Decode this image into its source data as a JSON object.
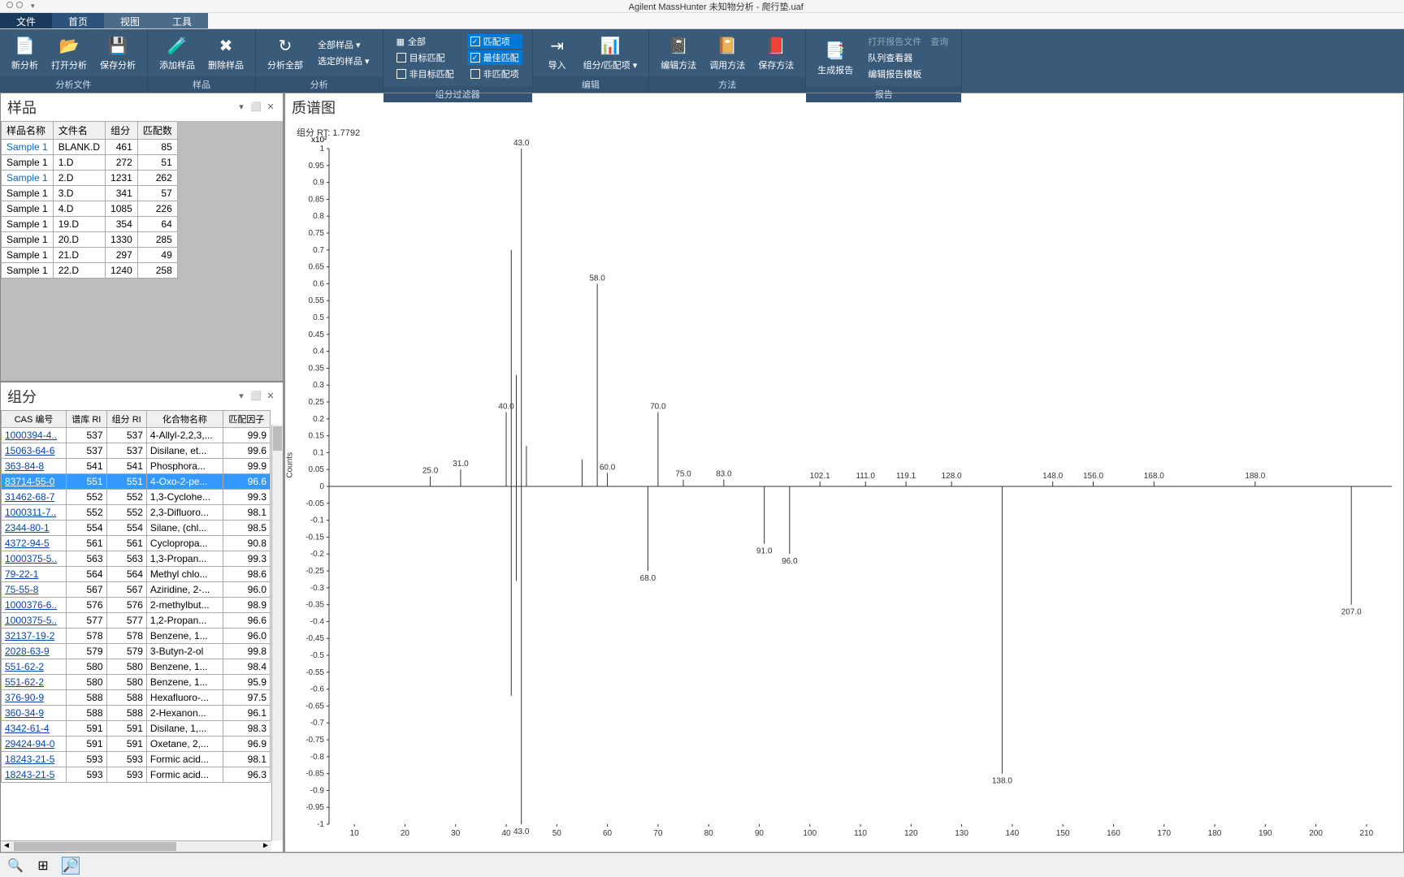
{
  "app_title": "Agilent MassHunter 未知物分析 - 爬行垫.uaf",
  "menu": {
    "file": "文件",
    "home": "首页",
    "view": "视图",
    "tools": "工具"
  },
  "ribbon": {
    "group1": {
      "label": "分析文件",
      "new": "新分析",
      "open": "打开分析",
      "save": "保存分析"
    },
    "group2": {
      "label": "样品",
      "add": "添加样品",
      "remove": "删除样品"
    },
    "group3": {
      "label": "分析",
      "analyze": "分析全部",
      "all_samples": "全部样品 ▾",
      "selected": "选定的样品 ▾"
    },
    "group4": {
      "label": "组分过滤器",
      "all": "全部",
      "target": "目标匹配",
      "nontarget": "非目标匹配",
      "matched": "匹配项",
      "best": "最佳匹配",
      "unmatched": "非匹配项"
    },
    "group5": {
      "label": "编辑",
      "import": "导入",
      "comp": "组分/匹配项 ▾"
    },
    "group6": {
      "label": "方法",
      "edit": "编辑方法",
      "apply": "调用方法",
      "save": "保存方法"
    },
    "group7": {
      "label": "报告",
      "gen": "生成报告",
      "openrpt": "打开报告文件",
      "query": "查询",
      "queue": "队列查看器",
      "edittpl": "编辑报告模板"
    }
  },
  "panels": {
    "samples": "样品",
    "components": "组分",
    "spectrum": "质谱图"
  },
  "samples": {
    "cols": [
      "样品名称",
      "文件名",
      "组分",
      "匹配数"
    ],
    "rows": [
      [
        "Sample 1",
        "BLANK.D",
        "461",
        "85"
      ],
      [
        "Sample 1",
        "1.D",
        "272",
        "51"
      ],
      [
        "Sample 1",
        "2.D",
        "1231",
        "262"
      ],
      [
        "Sample 1",
        "3.D",
        "341",
        "57"
      ],
      [
        "Sample 1",
        "4.D",
        "1085",
        "226"
      ],
      [
        "Sample 1",
        "19.D",
        "354",
        "64"
      ],
      [
        "Sample 1",
        "20.D",
        "1330",
        "285"
      ],
      [
        "Sample 1",
        "21.D",
        "297",
        "49"
      ],
      [
        "Sample 1",
        "22.D",
        "1240",
        "258"
      ]
    ]
  },
  "components": {
    "cols": [
      "CAS 编号",
      "谱库 RI",
      "组分 RI",
      "化合物名称",
      "匹配因子"
    ],
    "rows": [
      [
        "1000394-4..",
        "537",
        "537",
        "4-Allyl-2,2,3,...",
        "99.9"
      ],
      [
        "15063-64-6",
        "537",
        "537",
        "Disilane, et...",
        "99.6"
      ],
      [
        "363-84-8",
        "541",
        "541",
        "Phosphora...",
        "99.9"
      ],
      [
        "83714-55-0",
        "551",
        "551",
        "4-Oxo-2-pe...",
        "96.6"
      ],
      [
        "31462-68-7",
        "552",
        "552",
        "1,3-Cyclohe...",
        "99.3"
      ],
      [
        "1000311-7..",
        "552",
        "552",
        "2,3-Difluoro...",
        "98.1"
      ],
      [
        "2344-80-1",
        "554",
        "554",
        "Silane, (chl...",
        "98.5"
      ],
      [
        "4372-94-5",
        "561",
        "561",
        "Cyclopropa...",
        "90.8"
      ],
      [
        "1000375-5..",
        "563",
        "563",
        "1,3-Propan...",
        "99.3"
      ],
      [
        "79-22-1",
        "564",
        "564",
        "Methyl chlo...",
        "98.6"
      ],
      [
        "75-55-8",
        "567",
        "567",
        "Aziridine, 2-...",
        "96.0"
      ],
      [
        "1000376-6..",
        "576",
        "576",
        "2-methylbut...",
        "98.9"
      ],
      [
        "1000375-5..",
        "577",
        "577",
        "1,2-Propan...",
        "96.6"
      ],
      [
        "32137-19-2",
        "578",
        "578",
        "Benzene, 1...",
        "96.0"
      ],
      [
        "2028-63-9",
        "579",
        "579",
        "3-Butyn-2-ol",
        "99.8"
      ],
      [
        "551-62-2",
        "580",
        "580",
        "Benzene, 1...",
        "98.4"
      ],
      [
        "551-62-2",
        "580",
        "580",
        "Benzene, 1...",
        "95.9"
      ],
      [
        "376-90-9",
        "588",
        "588",
        "Hexafluoro-...",
        "97.5"
      ],
      [
        "360-34-9",
        "588",
        "588",
        "2-Hexanon...",
        "96.1"
      ],
      [
        "4342-61-4",
        "591",
        "591",
        "Disilane, 1,...",
        "98.3"
      ],
      [
        "29424-94-0",
        "591",
        "591",
        "Oxetane, 2,...",
        "96.9"
      ],
      [
        "18243-21-5",
        "593",
        "593",
        "Formic acid...",
        "98.1"
      ],
      [
        "18243-21-5",
        "593",
        "593",
        "Formic acid...",
        "96.3"
      ]
    ],
    "highlight_index": 3
  },
  "chart_data": {
    "type": "bar",
    "title": "组分 RT: 1.7792",
    "ylabel": "Counts",
    "ymult": "x10²",
    "ylim": [
      -1,
      1
    ],
    "yticks": [
      1,
      0.95,
      0.9,
      0.85,
      0.8,
      0.75,
      0.7,
      0.65,
      0.6,
      0.55,
      0.5,
      0.45,
      0.4,
      0.35,
      0.3,
      0.25,
      0.2,
      0.15,
      0.1,
      0.05,
      0,
      -0.05,
      -0.1,
      -0.15,
      -0.2,
      -0.25,
      -0.3,
      -0.35,
      -0.4,
      -0.45,
      -0.5,
      -0.55,
      -0.6,
      -0.65,
      -0.7,
      -0.75,
      -0.8,
      -0.85,
      -0.9,
      -0.95,
      -1
    ],
    "xticks": [
      10,
      20,
      30,
      40,
      50,
      60,
      70,
      80,
      90,
      100,
      110,
      120,
      130,
      140,
      150,
      160,
      170,
      180,
      190,
      200,
      210
    ],
    "upper_peaks": [
      {
        "x": 25,
        "y": 0.03,
        "label": "25.0"
      },
      {
        "x": 31,
        "y": 0.05,
        "label": "31.0"
      },
      {
        "x": 40,
        "y": 0.22,
        "label": "40.0"
      },
      {
        "x": 41,
        "y": 0.7,
        "label": ""
      },
      {
        "x": 42,
        "y": 0.33,
        "label": ""
      },
      {
        "x": 43,
        "y": 1.0,
        "label": "43.0"
      },
      {
        "x": 44,
        "y": 0.12,
        "label": ""
      },
      {
        "x": 55,
        "y": 0.08,
        "label": ""
      },
      {
        "x": 58,
        "y": 0.6,
        "label": "58.0"
      },
      {
        "x": 60,
        "y": 0.04,
        "label": "60.0"
      },
      {
        "x": 70,
        "y": 0.22,
        "label": "70.0"
      },
      {
        "x": 75,
        "y": 0.02,
        "label": "75.0"
      },
      {
        "x": 83,
        "y": 0.02,
        "label": "83.0"
      },
      {
        "x": 102,
        "y": 0.015,
        "label": "102.1"
      },
      {
        "x": 111,
        "y": 0.015,
        "label": "111.0"
      },
      {
        "x": 119,
        "y": 0.015,
        "label": "119.1"
      },
      {
        "x": 128,
        "y": 0.015,
        "label": "128.0"
      },
      {
        "x": 148,
        "y": 0.015,
        "label": "148.0"
      },
      {
        "x": 156,
        "y": 0.015,
        "label": "156.0"
      },
      {
        "x": 168,
        "y": 0.015,
        "label": "168.0"
      },
      {
        "x": 188,
        "y": 0.015,
        "label": "188.0"
      }
    ],
    "lower_peaks": [
      {
        "x": 43,
        "y": -1.0,
        "label": "43.0"
      },
      {
        "x": 41,
        "y": -0.62,
        "label": ""
      },
      {
        "x": 42,
        "y": -0.28,
        "label": ""
      },
      {
        "x": 68,
        "y": -0.25,
        "label": "68.0"
      },
      {
        "x": 91,
        "y": -0.17,
        "label": "91.0"
      },
      {
        "x": 96,
        "y": -0.2,
        "label": "96.0"
      },
      {
        "x": 138,
        "y": -0.85,
        "label": "138.0"
      },
      {
        "x": 207,
        "y": -0.35,
        "label": "207.0"
      }
    ]
  }
}
